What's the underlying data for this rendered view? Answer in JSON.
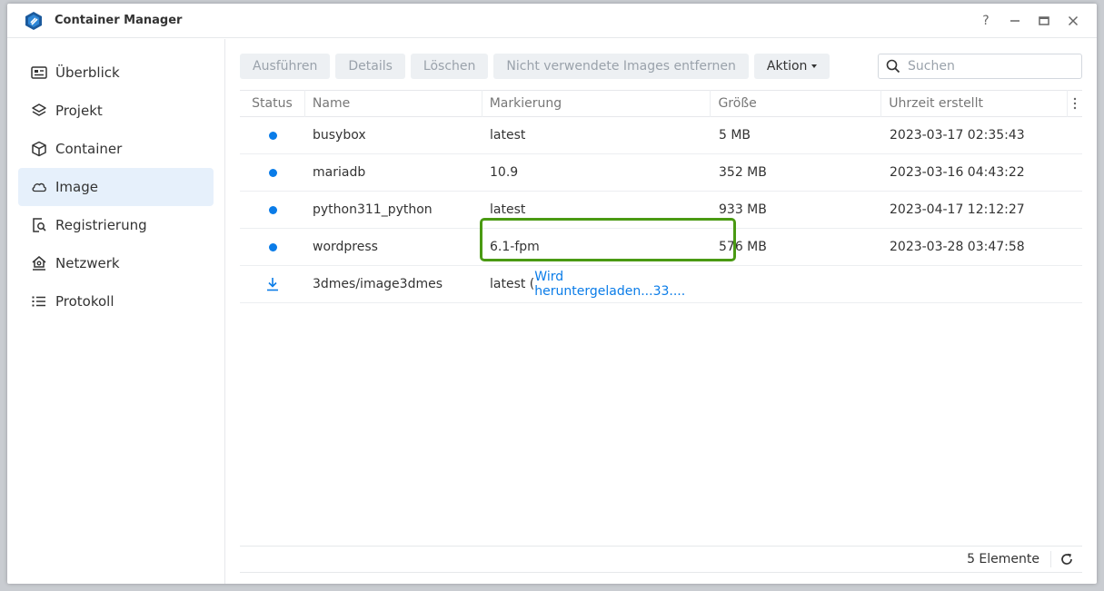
{
  "window": {
    "title": "Container Manager"
  },
  "window_controls": {
    "help": "?"
  },
  "sidebar": {
    "items": [
      {
        "label": "Überblick",
        "icon": "overview-icon",
        "active": false
      },
      {
        "label": "Projekt",
        "icon": "layers-icon",
        "active": false
      },
      {
        "label": "Container",
        "icon": "cube-icon",
        "active": false
      },
      {
        "label": "Image",
        "icon": "cloud-icon",
        "active": true
      },
      {
        "label": "Registrierung",
        "icon": "registry-search-icon",
        "active": false
      },
      {
        "label": "Netzwerk",
        "icon": "network-house-icon",
        "active": false
      },
      {
        "label": "Protokoll",
        "icon": "list-icon",
        "active": false
      }
    ]
  },
  "toolbar": {
    "run": "Ausführen",
    "details": "Details",
    "delete": "Löschen",
    "remove_unused": "Nicht verwendete Images entfernen",
    "action": "Aktion"
  },
  "search": {
    "placeholder": "Suchen"
  },
  "table": {
    "headers": {
      "status": "Status",
      "name": "Name",
      "tag": "Markierung",
      "size": "Größe",
      "created": "Uhrzeit erstellt"
    },
    "rows": [
      {
        "status": "running",
        "name": "busybox",
        "tag": "latest",
        "size": "5 MB",
        "created": "2023-03-17 02:35:43"
      },
      {
        "status": "running",
        "name": "mariadb",
        "tag": "10.9",
        "size": "352 MB",
        "created": "2023-03-16 04:43:22"
      },
      {
        "status": "running",
        "name": "python311_python",
        "tag": "latest",
        "size": "933 MB",
        "created": "2023-04-17 12:12:27"
      },
      {
        "status": "running",
        "name": "wordpress",
        "tag": "6.1-fpm",
        "size": "576 MB",
        "created": "2023-03-28 03:47:58"
      },
      {
        "status": "downloading",
        "name": "3dmes/image3dmes",
        "tag": "latest (",
        "tag_progress": "Wird heruntergeladen...33....",
        "size": "",
        "created": ""
      }
    ]
  },
  "footer": {
    "count": "5 Elemente"
  },
  "colors": {
    "accent": "#0a7ce8",
    "highlight": "#4a9a13"
  }
}
